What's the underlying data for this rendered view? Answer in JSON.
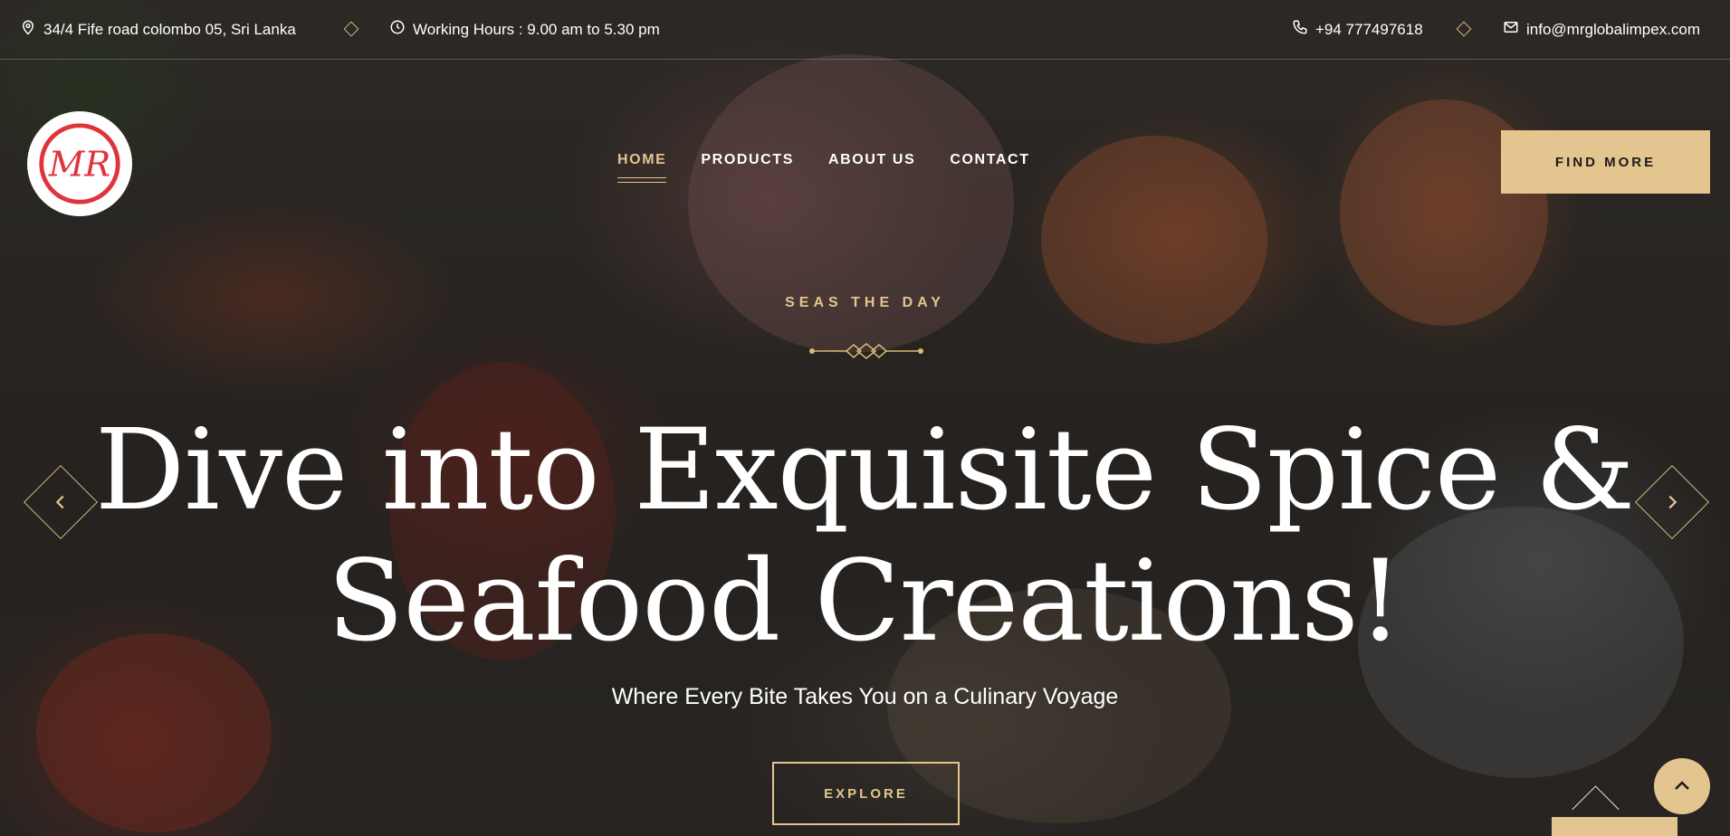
{
  "topbar": {
    "address": "34/4 Fife road colombo 05, Sri Lanka",
    "hours": "Working Hours : 9.00 am to 5.30 pm",
    "phone": "+94 777497618",
    "email": "info@mrglobalimpex.com"
  },
  "logo": {
    "text": "MR"
  },
  "nav": {
    "items": [
      {
        "label": "HOME",
        "active": true
      },
      {
        "label": "PRODUCTS",
        "active": false
      },
      {
        "label": "ABOUT US",
        "active": false
      },
      {
        "label": "CONTACT",
        "active": false
      }
    ]
  },
  "header": {
    "cta_label": "FIND MORE"
  },
  "hero": {
    "eyebrow": "SEAS THE DAY",
    "headline_line1": "Dive into Exquisite Spice &",
    "headline_line2": "Seafood Creations!",
    "subline": "Where Every Bite Takes You on a Culinary Voyage",
    "button_label": "EXPLORE"
  },
  "colors": {
    "accent": "#e4c48f",
    "logo_red": "#e0333a",
    "text": "#ffffff"
  },
  "icons": [
    "location-icon",
    "clock-icon",
    "phone-icon",
    "mail-icon",
    "chevron-left-icon",
    "chevron-right-icon",
    "chevron-up-icon"
  ]
}
